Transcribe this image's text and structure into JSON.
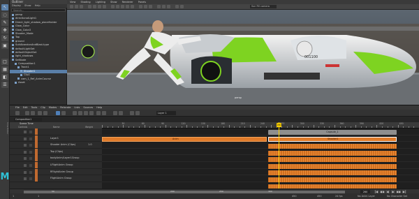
{
  "outliner": {
    "title": "Outliner",
    "menu": [
      "Display",
      "Show",
      "Help"
    ],
    "search_placeholder": "Search...",
    "items": [
      {
        "label": "persp",
        "selected": false
      },
      {
        "label": "directionalLight1",
        "selected": false
      },
      {
        "label": "Direct_light_shadow_placeHolder",
        "selected": false
      },
      {
        "label": "Glow_Color",
        "selected": false
      },
      {
        "label": "Glow_Color2",
        "selected": false
      },
      {
        "label": "Shooter_Mode",
        "selected": false
      },
      {
        "label": "Top",
        "selected": false
      },
      {
        "label": "ground",
        "selected": false
      },
      {
        "label": "SuitAbandonAndBlast.type",
        "selected": false
      },
      {
        "label": "defaultLightSet",
        "selected": false
      },
      {
        "label": "defaultObjectSet",
        "selected": false
      },
      {
        "label": "light_shadows",
        "selected": false
      },
      {
        "label": "SetNode",
        "selected": false
      },
      {
        "label": "Composition1",
        "selected": false
      },
      {
        "label": "Track1",
        "selected": false
      },
      {
        "label": "Shooter1",
        "selected": true
      },
      {
        "label": "Clip1",
        "selected": false
      },
      {
        "label": "cam_1_Ref_AnimCourse",
        "selected": false
      },
      {
        "label": "Asset",
        "selected": false
      }
    ]
  },
  "viewport": {
    "menu": [
      "View",
      "Shading",
      "Lighting",
      "Show",
      "Renderer",
      "Panels"
    ],
    "camera_field": "Sun Fill camera",
    "hud_label": "persp",
    "ship_text": "001100"
  },
  "time_editor": {
    "side_label": "Time Editor",
    "menu": [
      "File",
      "Edit",
      "Tools",
      "Clip",
      "Modes",
      "Relocate",
      "Lists",
      "Sources",
      "Help"
    ],
    "composition_field": "Composition1",
    "layer_field": "Layer 1",
    "tracks_header": {
      "title": "Scene Time",
      "col_1": "Controls",
      "col_2": "Name",
      "col_3": "Weight"
    },
    "tracks": [
      {
        "name": "",
        "weight": ""
      },
      {
        "name": "Layer1",
        "weight": ""
      },
      {
        "name": "Shooter Anim (Clips)",
        "weight": "1.0"
      },
      {
        "name": "Top (Clips)",
        "weight": ""
      },
      {
        "name": "bodyAnim/Layer1Group",
        "weight": ""
      },
      {
        "name": "LFlightAnim Group",
        "weight": ""
      },
      {
        "name": "RFlightAnim Group",
        "weight": ""
      },
      {
        "name": "FlightAnim Group",
        "weight": ""
      }
    ],
    "ruler_labels": [
      "30",
      "60",
      "90",
      "120",
      "150",
      "180",
      "210",
      "240",
      "270",
      "300",
      "330",
      "360",
      "390",
      "420",
      "450"
    ],
    "current_frame": "260",
    "clips": {
      "capsule": "Capsule_1",
      "anim": "Anim",
      "shooter": "Shooter1"
    },
    "bottom_ruler_labels": [
      "50",
      "200",
      "250",
      "300"
    ],
    "frame_field": "260",
    "playback_buttons": [
      "|◀",
      "◀◀",
      "◀",
      "▶",
      "▶▶",
      "▶|"
    ]
  },
  "status": {
    "start_frame": "1",
    "end_frame": "1",
    "range_start": "450",
    "range_end": "450",
    "fps": "24 fps",
    "anim_layer": "No Anim Layer",
    "character": "No Character Set"
  },
  "colors": {
    "accent": "#5a7fa8",
    "clip": "#e07b2a",
    "playhead": "#ffd200",
    "logo": "#2fc1d6"
  }
}
